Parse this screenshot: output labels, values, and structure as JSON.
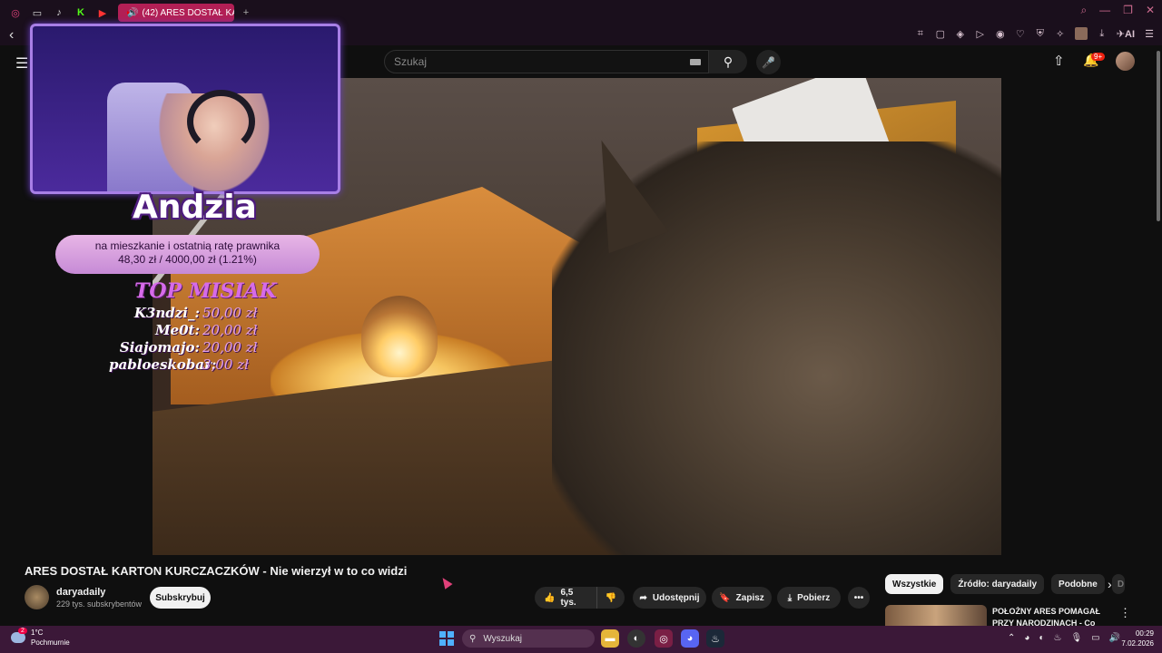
{
  "browser": {
    "active_tab": "(42) ARES DOSTAŁ KA",
    "tab_add": "+",
    "back": "‹",
    "win_search": "⌕",
    "win_min": "—",
    "win_restore": "❐",
    "win_close": "✕",
    "ai_label": "AI"
  },
  "header": {
    "search_placeholder": "Szukaj",
    "notif_count": "9+"
  },
  "overlay": {
    "streamer_name": "Andzia",
    "goal_text": "na mieszkanie i ostatnią ratę prawnika",
    "goal_progress": "48,30 zł  /  4000,00 zł  (1.21%)",
    "goal_fraction": 0.0121,
    "top_title": "TOP MISIAK",
    "top_donors": [
      {
        "name": "K3ndzi_:",
        "amount": "50,00 zł"
      },
      {
        "name": "Me0t:",
        "amount": "20,00 zł"
      },
      {
        "name": "Siajomajo:",
        "amount": "20,00 zł"
      },
      {
        "name": "pabloeskobar:",
        "amount": "3,00 zł"
      }
    ]
  },
  "video": {
    "title": "ARES DOSTAŁ KARTON KURCZACZKÓW - Nie wierzył w to co widzi",
    "channel": "daryadaily",
    "subscribers": "229 tys. subskrybentów",
    "subscribe_label": "Subskrybuj",
    "like_count": "6,5 tys.",
    "share_label": "Udostępnij",
    "save_label": "Zapisz",
    "download_label": "Pobierz"
  },
  "sidebar": {
    "chips": [
      "Wszystkie",
      "Źródło: daryadaily",
      "Podobne",
      "D"
    ],
    "rec_title": "POŁOŻNY ARES POMAGAŁ PRZY NARODZINACH - Co on"
  },
  "taskbar": {
    "temp": "1°C",
    "weather": "Pochmurnie",
    "weather_badge": "2",
    "search_label": "Wyszukaj",
    "time": "00:29",
    "date": "7.02.2026"
  },
  "colors": {
    "accent_tab": "#b21f55",
    "overlay_purple": "#a87fe6",
    "taskbar": "#3b1838",
    "subscribe_bg": "#f1f1f1"
  }
}
